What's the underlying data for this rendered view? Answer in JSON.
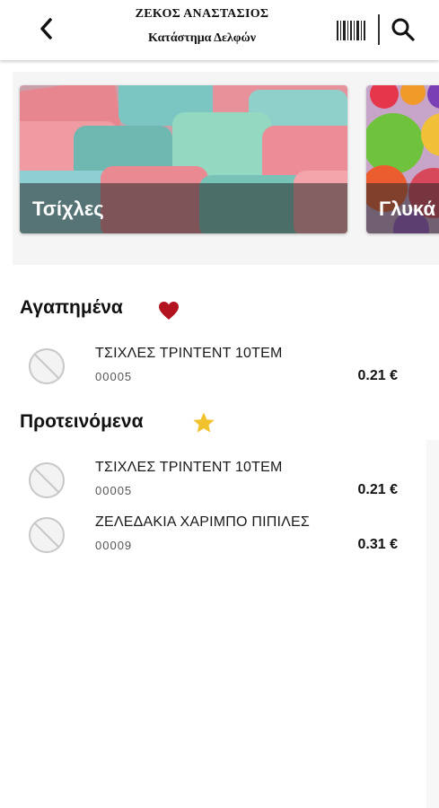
{
  "header": {
    "owner": "ΖΕΚΟΣ ΑΝΑΣΤΑΣΙΟΣ",
    "store": "Κατάστημα Δελφών"
  },
  "categories": [
    {
      "label": "Τσίχλες"
    },
    {
      "label": "Γλυκά"
    }
  ],
  "favorites": {
    "title": "Αγαπημένα",
    "items": [
      {
        "name": "ΤΣΙΧΛΕΣ ΤΡΙΝΤΕΝΤ 10ΤΕΜ",
        "code": "00005",
        "price": "0.21 €"
      }
    ]
  },
  "recommended": {
    "title": "Προτεινόμενα",
    "items": [
      {
        "name": "ΤΣΙΧΛΕΣ ΤΡΙΝΤΕΝΤ 10ΤΕΜ",
        "code": "00005",
        "price": "0.21 €"
      },
      {
        "name": "ΖΕΛΕΔΑΚΙΑ ΧΑΡΙΜΠΟ ΠΙΠΙΛΕΣ",
        "code": "00009",
        "price": "0.31 €"
      }
    ]
  },
  "colors": {
    "heart": "#b3121f",
    "star": "#f2c12e",
    "header_bg": "#ffffff"
  },
  "icons": {
    "back": "chevron-left-icon",
    "barcode": "barcode-icon",
    "search": "search-icon",
    "favorite": "heart-icon",
    "recommended": "star-icon"
  }
}
